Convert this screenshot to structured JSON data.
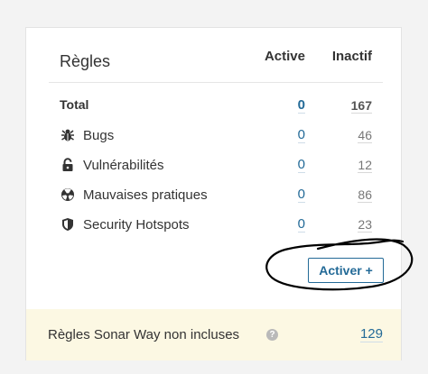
{
  "header": {
    "title": "Règles",
    "active_label": "Active",
    "inactive_label": "Inactif"
  },
  "rows": [
    {
      "label": "Total",
      "active": "0",
      "inactive": "167",
      "icon": ""
    },
    {
      "label": "Bugs",
      "active": "0",
      "inactive": "46",
      "icon": "bug-icon"
    },
    {
      "label": "Vulnérabilités",
      "active": "0",
      "inactive": "12",
      "icon": "lock-icon"
    },
    {
      "label": "Mauvaises pratiques",
      "active": "0",
      "inactive": "86",
      "icon": "code-smell-icon"
    },
    {
      "label": "Security Hotspots",
      "active": "0",
      "inactive": "23",
      "icon": "shield-icon"
    }
  ],
  "activate_button": {
    "label": "Activer +"
  },
  "footer": {
    "label": "Règles Sonar Way non incluses",
    "count": "129",
    "help_icon": "question-icon"
  },
  "colors": {
    "link": "#236a97",
    "footer_bg": "#fcf8e3",
    "annotation": "#000000"
  }
}
